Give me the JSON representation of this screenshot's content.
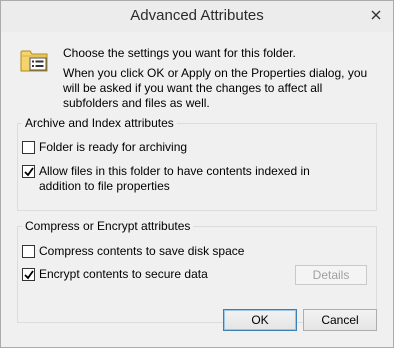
{
  "window": {
    "title": "Advanced Attributes"
  },
  "intro": {
    "line1": "Choose the settings you want for this folder.",
    "line2": "When you click OK or Apply on the Properties dialog, you will be asked if you want the changes to affect all subfolders and files as well."
  },
  "archive_group": {
    "legend": "Archive and Index attributes",
    "archiving": {
      "label": "Folder is ready for archiving",
      "checked": false
    },
    "indexing": {
      "label": "Allow files in this folder to have contents indexed in addition to file properties",
      "checked": true
    }
  },
  "compress_group": {
    "legend": "Compress or Encrypt attributes",
    "compress": {
      "label": "Compress contents to save disk space",
      "checked": false
    },
    "encrypt": {
      "label": "Encrypt contents to secure data",
      "checked": true
    },
    "details_label": "Details"
  },
  "buttons": {
    "ok": "OK",
    "cancel": "Cancel"
  },
  "icons": {
    "close": "close-icon",
    "folder": "folder-properties-icon",
    "check": "checkmark-icon"
  }
}
